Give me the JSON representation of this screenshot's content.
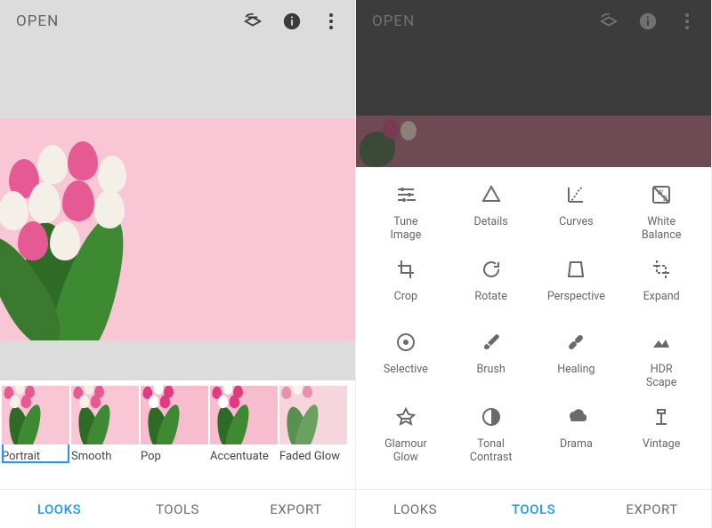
{
  "accent": "#2196f3",
  "left": {
    "header": {
      "open": "OPEN"
    },
    "looks": [
      {
        "label": "Portrait"
      },
      {
        "label": "Smooth"
      },
      {
        "label": "Pop"
      },
      {
        "label": "Accentuate"
      },
      {
        "label": "Faded Glow"
      }
    ],
    "nav": {
      "looks": "LOOKS",
      "tools": "TOOLS",
      "export": "EXPORT",
      "active": "looks"
    }
  },
  "right": {
    "header": {
      "open": "OPEN"
    },
    "tools": [
      {
        "name": "tune-image",
        "label": "Tune Image"
      },
      {
        "name": "details",
        "label": "Details"
      },
      {
        "name": "curves",
        "label": "Curves"
      },
      {
        "name": "white-balance",
        "label": "White Balance"
      },
      {
        "name": "crop",
        "label": "Crop"
      },
      {
        "name": "rotate",
        "label": "Rotate"
      },
      {
        "name": "perspective",
        "label": "Perspective"
      },
      {
        "name": "expand",
        "label": "Expand"
      },
      {
        "name": "selective",
        "label": "Selective"
      },
      {
        "name": "brush",
        "label": "Brush"
      },
      {
        "name": "healing",
        "label": "Healing"
      },
      {
        "name": "hdr-scape",
        "label": "HDR Scape"
      },
      {
        "name": "glamour-glow",
        "label": "Glamour Glow"
      },
      {
        "name": "tonal-contrast",
        "label": "Tonal Contrast"
      },
      {
        "name": "drama",
        "label": "Drama"
      },
      {
        "name": "vintage",
        "label": "Vintage"
      }
    ],
    "nav": {
      "looks": "LOOKS",
      "tools": "TOOLS",
      "export": "EXPORT",
      "active": "tools"
    }
  }
}
